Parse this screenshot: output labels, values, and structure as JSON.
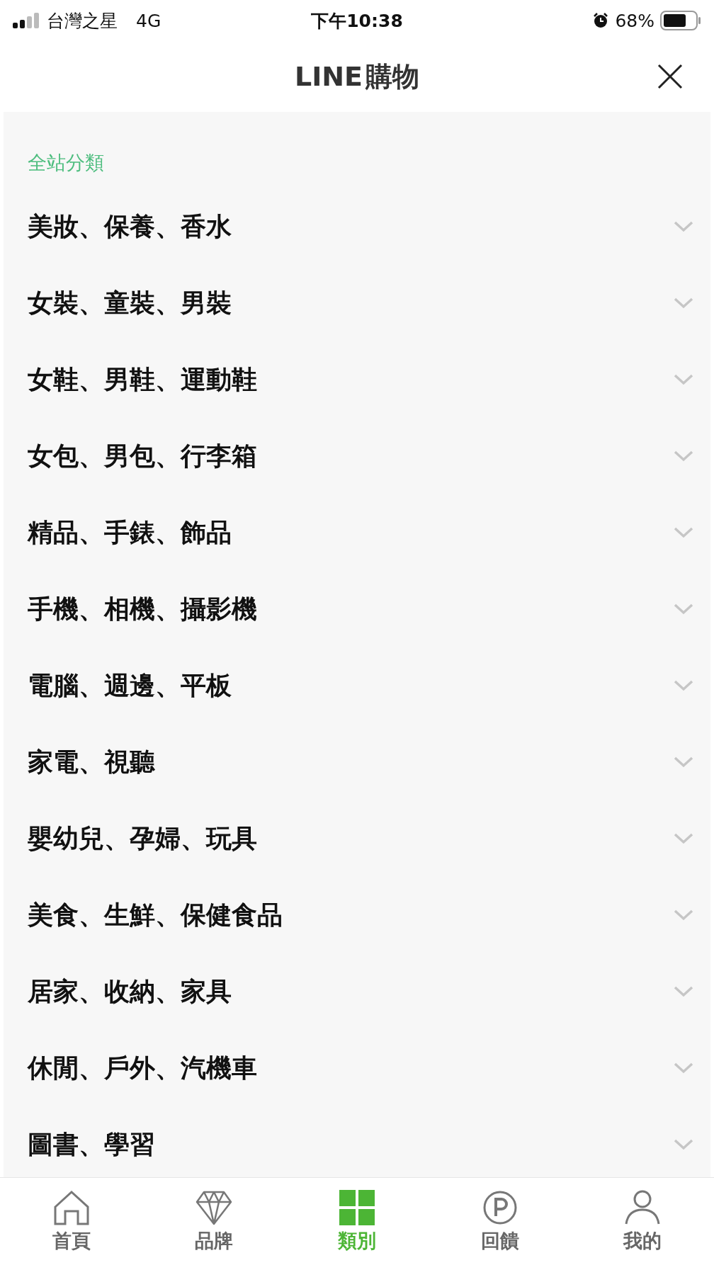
{
  "status_bar": {
    "carrier": "台灣之星",
    "network": "4G",
    "time": "下午10:38",
    "battery": "68%"
  },
  "header": {
    "title_latin": "LINE",
    "title_cjk": "購物"
  },
  "section_title": "全站分類",
  "categories": [
    {
      "label": "美妝、保養、香水",
      "expanded": false
    },
    {
      "label": "女裝、童裝、男裝",
      "expanded": false
    },
    {
      "label": "女鞋、男鞋、運動鞋",
      "expanded": false
    },
    {
      "label": "女包、男包、行李箱",
      "expanded": false
    },
    {
      "label": "精品、手錶、飾品",
      "expanded": false
    },
    {
      "label": "手機、相機、攝影機",
      "expanded": false
    },
    {
      "label": "電腦、週邊、平板",
      "expanded": false
    },
    {
      "label": "家電、視聽",
      "expanded": false
    },
    {
      "label": "嬰幼兒、孕婦、玩具",
      "expanded": false
    },
    {
      "label": "美食、生鮮、保健食品",
      "expanded": false
    },
    {
      "label": "居家、收納、家具",
      "expanded": false
    },
    {
      "label": "休閒、戶外、汽機車",
      "expanded": false
    },
    {
      "label": "圖書、學習",
      "expanded": false
    }
  ],
  "tabs": [
    {
      "label": "首頁",
      "kind": "home",
      "selected": false
    },
    {
      "label": "品牌",
      "kind": "brand",
      "selected": false
    },
    {
      "label": "類別",
      "kind": "category",
      "selected": true
    },
    {
      "label": "回饋",
      "kind": "points",
      "selected": false
    },
    {
      "label": "我的",
      "kind": "account",
      "selected": false
    }
  ]
}
